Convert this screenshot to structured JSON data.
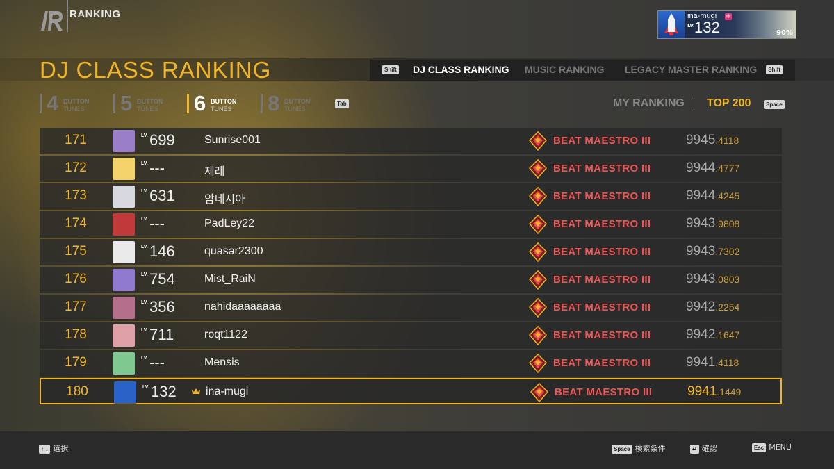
{
  "header": {
    "section": "RANKING",
    "profile": {
      "name": "ina-mugi",
      "plus": "+",
      "lv_label": "LV.",
      "level": "132",
      "percent": "90%"
    }
  },
  "title": "DJ CLASS RANKING",
  "ranking_tabs": {
    "left_key": "Shift",
    "right_key": "Shift",
    "items": [
      {
        "label": "DJ CLASS RANKING",
        "active": true
      },
      {
        "label": "MUSIC RANKING",
        "active": false
      },
      {
        "label": "LEGACY MASTER RANKING",
        "active": false
      }
    ]
  },
  "button_tabs": {
    "items": [
      {
        "num": "4",
        "w1": "BUTTON",
        "w2": "TUNES",
        "active": false
      },
      {
        "num": "5",
        "w1": "BUTTON",
        "w2": "TUNES",
        "active": false
      },
      {
        "num": "6",
        "w1": "BUTTON",
        "w2": "TUNES",
        "active": true
      },
      {
        "num": "8",
        "w1": "BUTTON",
        "w2": "TUNES",
        "active": false
      }
    ],
    "tab_key": "Tab"
  },
  "view_toggle": {
    "my_ranking": "MY RANKING",
    "top200": "TOP 200",
    "key": "Space"
  },
  "rows": [
    {
      "rank": "171",
      "lv_label": "LV.",
      "level": "699",
      "name": "Sunrise001",
      "cls": "BEAT MAESTRO  III",
      "score_int": "9945",
      "score_dec": ".4118",
      "avatar": "#9a7fc8",
      "me": false
    },
    {
      "rank": "172",
      "lv_label": "LV.",
      "level": "---",
      "name": "제레",
      "cls": "BEAT MAESTRO  III",
      "score_int": "9944",
      "score_dec": ".4777",
      "avatar": "#f3d36a",
      "me": false
    },
    {
      "rank": "173",
      "lv_label": "LV.",
      "level": "631",
      "name": "암네시아",
      "cls": "BEAT MAESTRO  III",
      "score_int": "9944",
      "score_dec": ".4245",
      "avatar": "#d8d8e0",
      "me": false
    },
    {
      "rank": "174",
      "lv_label": "LV.",
      "level": "---",
      "name": "PadLey22",
      "cls": "BEAT MAESTRO  III",
      "score_int": "9943",
      "score_dec": ".9808",
      "avatar": "#c03a3a",
      "me": false
    },
    {
      "rank": "175",
      "lv_label": "LV.",
      "level": "146",
      "name": "quasar2300",
      "cls": "BEAT MAESTRO  III",
      "score_int": "9943",
      "score_dec": ".7302",
      "avatar": "#eaeaea",
      "me": false
    },
    {
      "rank": "176",
      "lv_label": "LV.",
      "level": "754",
      "name": "Mist_RaiN",
      "cls": "BEAT MAESTRO  III",
      "score_int": "9943",
      "score_dec": ".0803",
      "avatar": "#8f7ad0",
      "me": false
    },
    {
      "rank": "177",
      "lv_label": "LV.",
      "level": "356",
      "name": "nahidaaaaaaaa",
      "cls": "BEAT MAESTRO  III",
      "score_int": "9942",
      "score_dec": ".2254",
      "avatar": "#b4708a",
      "me": false
    },
    {
      "rank": "178",
      "lv_label": "LV.",
      "level": "711",
      "name": "roqt1122",
      "cls": "BEAT MAESTRO  III",
      "score_int": "9942",
      "score_dec": ".1647",
      "avatar": "#e0a0a8",
      "me": false
    },
    {
      "rank": "179",
      "lv_label": "LV.",
      "level": "---",
      "name": "Mensis",
      "cls": "BEAT MAESTRO  III",
      "score_int": "9941",
      "score_dec": ".4118",
      "avatar": "#7fc890",
      "me": false
    },
    {
      "rank": "180",
      "lv_label": "LV.",
      "level": "132",
      "name": "ina-mugi",
      "cls": "BEAT MAESTRO  III",
      "score_int": "9941",
      "score_dec": ".1449",
      "avatar": "#2a62c8",
      "me": true
    }
  ],
  "footer": {
    "select_key": "↑ ↓",
    "select": "選択",
    "search_key": "Space",
    "search": "検索条件",
    "confirm_key": "↵",
    "confirm": "確認",
    "menu_key": "Esc",
    "menu": "MENU"
  },
  "colors": {
    "accent": "#f0b429",
    "class_red": "#ee5555"
  }
}
